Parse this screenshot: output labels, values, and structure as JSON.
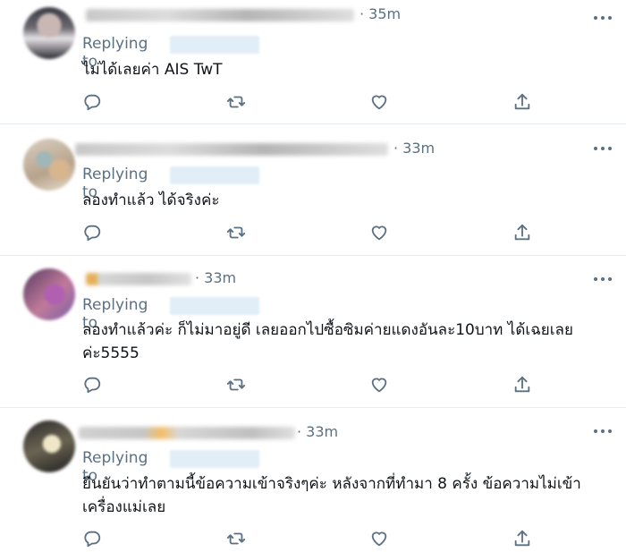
{
  "replying_to_label": "Replying to",
  "tweets": [
    {
      "time": "· 35m",
      "text": "ไม่ได้เลยค่า AIS TwT"
    },
    {
      "time": "· 33m",
      "text": "ลองทำแล้ว ได้จริงค่ะ"
    },
    {
      "time": "· 33m",
      "text": "ลองทำแล้วค่ะ ก็ไม่มาอยู่ดี เลยออกไปซื้อซิมค่ายแดงอันละ10บาท ได้เฉยเลยค่ะ5555"
    },
    {
      "time": "· 33m",
      "text": "ยืนยันว่าทำตามนี้ข้อความเข้าจริงๆค่ะ หลังจากที่ทำมา 8 ครั้ง ข้อความไม่เข้าเครื่องแม่เลย"
    }
  ],
  "icons": {
    "reply": "reply-icon",
    "retweet": "retweet-icon",
    "like": "heart-icon",
    "share": "share-icon",
    "more": "more-icon"
  },
  "colors": {
    "secondary_text": "#5b7083",
    "divider": "#e6ecf0",
    "handle_blur": "#e1eef7"
  }
}
